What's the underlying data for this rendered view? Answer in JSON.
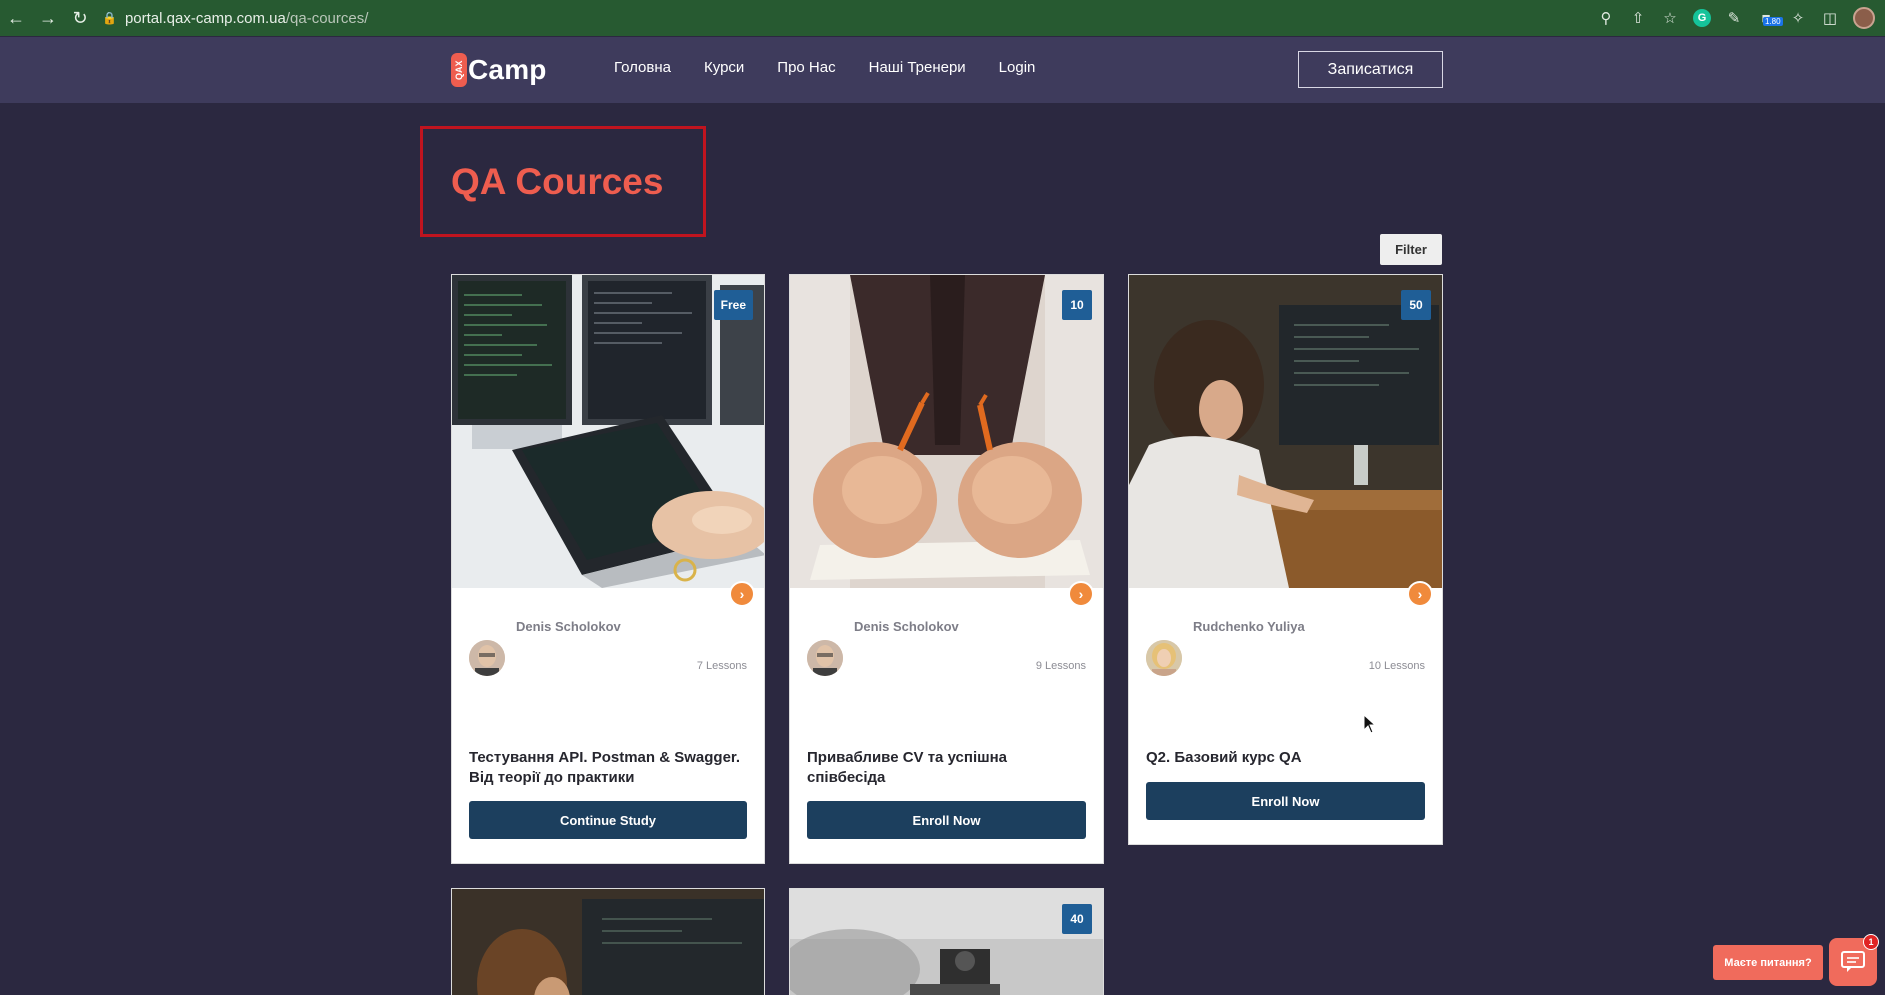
{
  "browser": {
    "url_host": "portal.qax-camp.com.ua",
    "url_path": "/qa-cources/",
    "extension_badge": "1.80"
  },
  "header": {
    "logo_mark": "QAX",
    "logo_word": "Camp",
    "menu": [
      "Головна",
      "Курси",
      "Про Нас",
      "Наші Тренери",
      "Login"
    ],
    "signup_label": "Записатися"
  },
  "page": {
    "title": "QA Cources",
    "filter_label": "Filter"
  },
  "courses": [
    {
      "price": "Free",
      "instructor": "Denis Scholokov",
      "lessons": "7 Lessons",
      "title": "Тестування API. Postman & Swagger. Від теорії до практики",
      "action": "Continue Study"
    },
    {
      "price": "10",
      "instructor": "Denis Scholokov",
      "lessons": "9 Lessons",
      "title": "Привабливе CV та успішна співбесіда",
      "action": "Enroll Now"
    },
    {
      "price": "50",
      "instructor": "Rudchenko Yuliya",
      "lessons": "10 Lessons",
      "title": "Q2. Базовий курс QA",
      "action": "Enroll Now"
    },
    {
      "price": ""
    },
    {
      "price": "40"
    }
  ],
  "chat": {
    "label": "Маєте питання?",
    "count": "1"
  }
}
